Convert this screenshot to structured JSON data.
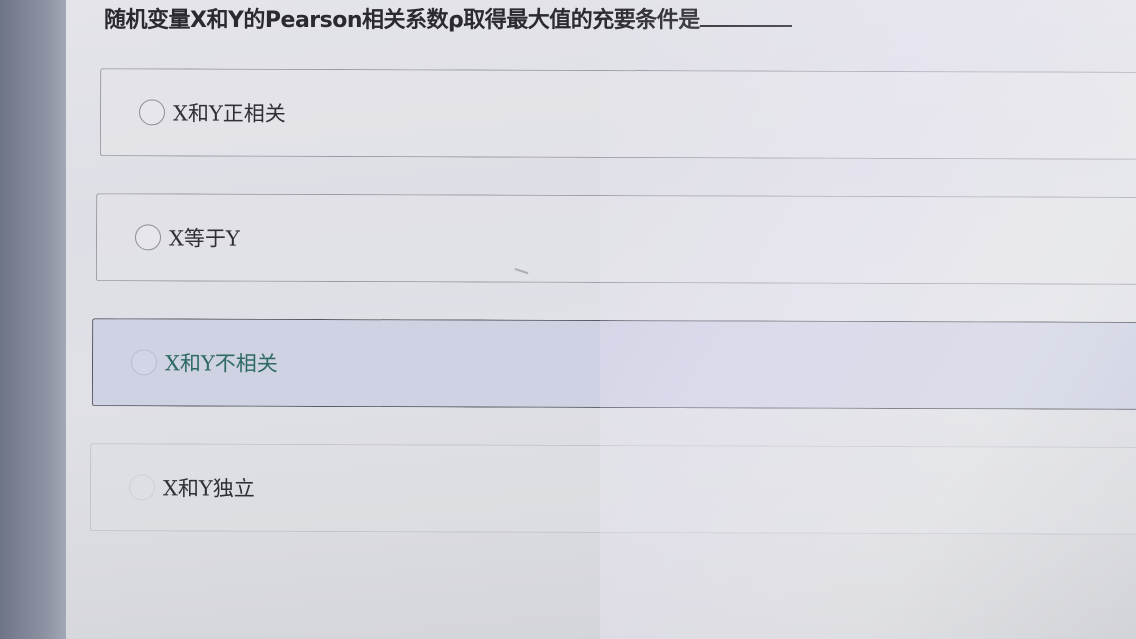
{
  "question": {
    "text": "随机变量X和Y的Pearson相关系数ρ取得最大值的充要条件是"
  },
  "options": [
    {
      "label": "X和Y正相关",
      "selected": false
    },
    {
      "label": "X等于Y",
      "selected": false
    },
    {
      "label": "X和Y不相关",
      "selected": false
    },
    {
      "label": "X和Y独立",
      "selected": false
    }
  ],
  "colors": {
    "highlight_option_bg": "#cfd2e3",
    "highlight_option_text": "#2d6a63",
    "text_primary": "#2a2a30"
  }
}
